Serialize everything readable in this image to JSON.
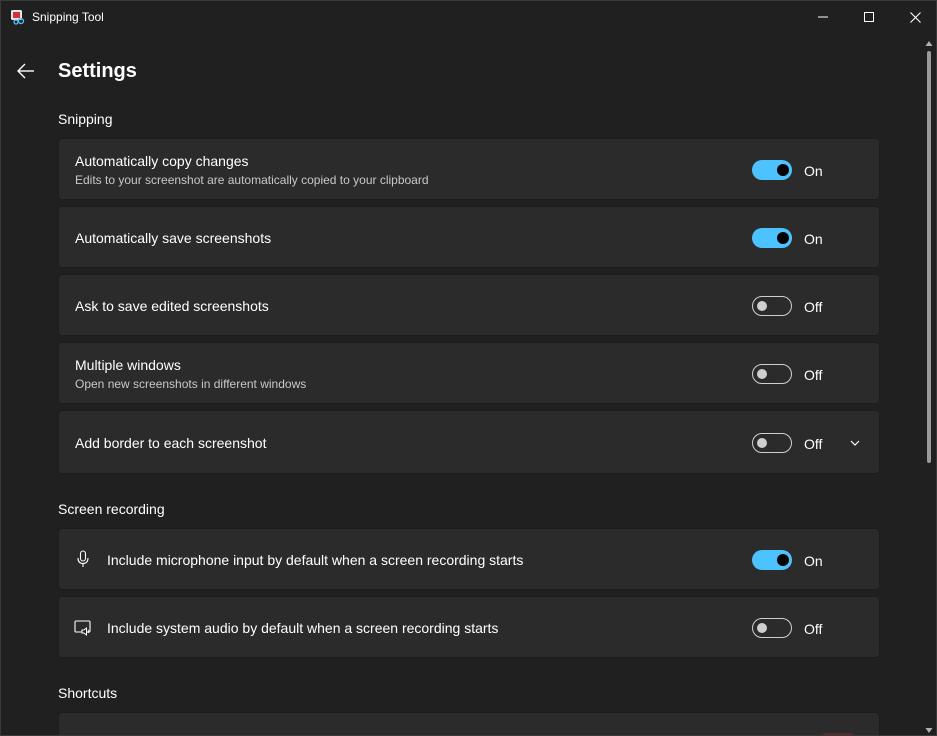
{
  "window": {
    "title": "Snipping Tool"
  },
  "header": {
    "title": "Settings"
  },
  "sections": {
    "snipping": "Snipping",
    "screen_recording": "Screen recording",
    "shortcuts": "Shortcuts"
  },
  "snipping_items": [
    {
      "label": "Automatically copy changes",
      "description": "Edits to your screenshot are automatically copied to your clipboard",
      "state": "On"
    },
    {
      "label": "Automatically save screenshots",
      "state": "On"
    },
    {
      "label": "Ask to save edited screenshots",
      "state": "Off"
    },
    {
      "label": "Multiple windows",
      "description": "Open new screenshots in different windows",
      "state": "Off"
    },
    {
      "label": "Add border to each screenshot",
      "state": "Off"
    }
  ],
  "recording_items": [
    {
      "label": "Include microphone input by default when a screen recording starts",
      "state": "On",
      "icon": "microphone-icon"
    },
    {
      "label": "Include system audio by default when a screen recording starts",
      "state": "Off",
      "icon": "system-audio-icon"
    }
  ],
  "colors": {
    "accent": "#4cc2ff",
    "background": "#202020",
    "card": "#2b2b2b"
  }
}
